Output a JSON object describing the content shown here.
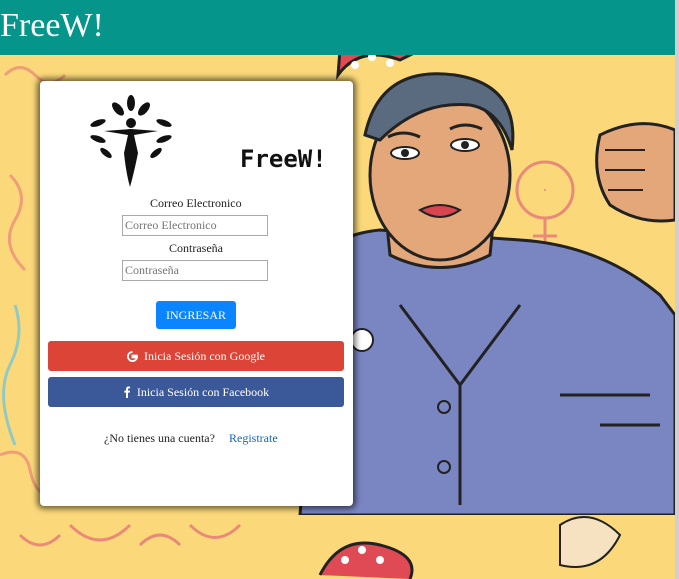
{
  "app": {
    "brand": "FreeW!"
  },
  "login": {
    "logo_text": "FreeW!",
    "email_label": "Correo Electronico",
    "email_placeholder": "Correo Electronico",
    "email_value": "",
    "password_label": "Contraseña",
    "password_placeholder": "Contraseña",
    "password_value": "",
    "submit_label": "INGRESAR",
    "google_label": "Inicia Sesión con Google",
    "facebook_label": "Inicia Sesión con Facebook",
    "signup_question": "¿No tienes una cuenta?",
    "signup_link": "Registrate"
  },
  "colors": {
    "topbar": "#05958a",
    "submit": "#0a84ff",
    "google": "#db4437",
    "facebook": "#3b5998",
    "link": "#1565c0",
    "background": "#fbd97a"
  },
  "icons": [
    "freew-logo-icon",
    "google-icon",
    "facebook-icon"
  ]
}
